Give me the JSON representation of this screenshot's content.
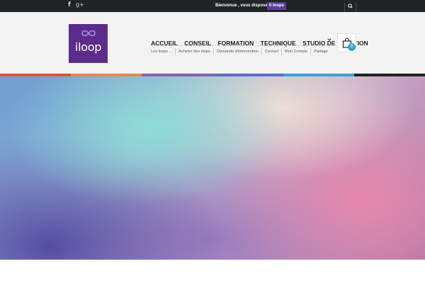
{
  "topbar": {
    "social": {
      "facebook": "f",
      "googleplus": "g+"
    },
    "welcome_text": "Bienvenue , vous disposez de",
    "loops_badge": "0 loops",
    "search_icon": "search-icon"
  },
  "logo": {
    "text": "iloop",
    "mark_icon": "infinity-icon"
  },
  "nav": {
    "main": [
      "ACCUEIL",
      "CONSEIL",
      "FORMATION",
      "TECHNIQUE",
      "STUDIO DE CRÉATION"
    ],
    "sub": [
      "Les loops ...",
      "Acheter des loops",
      "Demande d'intervention",
      "Contact",
      "Mon Compte",
      "Partage"
    ]
  },
  "cart": {
    "count": "0",
    "icon": "shopping-bag-icon"
  },
  "colors": {
    "topbar_bg": "#1f2428",
    "header_bg": "#f3f3f3",
    "brand_purple": "#5c2c8c",
    "badge_purple": "#5d3a9b",
    "cart_badge": "#29a7c5",
    "stripe": [
      "#d25a3c",
      "#e38b4d",
      "#8b5fa8",
      "#5b6fc9",
      "#36a3d6",
      "#222222"
    ]
  }
}
